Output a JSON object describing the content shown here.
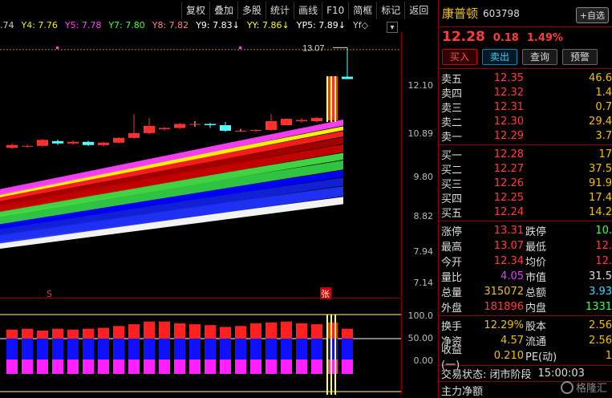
{
  "toolbar": [
    "复权",
    "叠加",
    "多股",
    "统计",
    "画线",
    "F10",
    "简框",
    "标记",
    "返回"
  ],
  "ma_row": [
    {
      "label": ".74",
      "color": "#cccccc"
    },
    {
      "label": "Y4: 7.76",
      "color": "#f0f000"
    },
    {
      "label": "Y5: 7.78",
      "color": "#ff40ff"
    },
    {
      "label": "Y7: 7.80",
      "color": "#40ff40"
    },
    {
      "label": "Y8: 7.82",
      "color": "#ff8080"
    },
    {
      "label": "Y9: 7.83↓",
      "color": "#ffffff"
    },
    {
      "label": "YY: 7.86↓",
      "color": "#ffff00"
    },
    {
      "label": "YP5: 7.89↓",
      "color": "#ffffff"
    },
    {
      "label": "Yf◇",
      "color": "#cccccc"
    }
  ],
  "ma_menu_icon": "menu-icon",
  "price_axis": [
    "12.10",
    "10.89",
    "9.80",
    "8.82",
    "7.94",
    "7.14"
  ],
  "osc_axis": [
    "100.0",
    "50.00",
    "0.00"
  ],
  "chart_annotations": {
    "high_label": "13.07",
    "s_marker": "S",
    "zhang_marker": "张"
  },
  "chart_data": {
    "type": "candlestick",
    "candles": [
      {
        "o": 10.55,
        "c": 10.62,
        "h": 10.66,
        "l": 10.52
      },
      {
        "o": 10.58,
        "c": 10.6,
        "h": 10.63,
        "l": 10.55
      },
      {
        "o": 10.6,
        "c": 10.75,
        "h": 10.78,
        "l": 10.57
      },
      {
        "o": 10.72,
        "c": 10.66,
        "h": 10.76,
        "l": 10.62
      },
      {
        "o": 10.66,
        "c": 10.7,
        "h": 10.74,
        "l": 10.63
      },
      {
        "o": 10.7,
        "c": 10.62,
        "h": 10.73,
        "l": 10.6
      },
      {
        "o": 10.62,
        "c": 10.68,
        "h": 10.7,
        "l": 10.58
      },
      {
        "o": 10.68,
        "c": 10.8,
        "h": 10.82,
        "l": 10.66
      },
      {
        "o": 10.8,
        "c": 10.92,
        "h": 11.4,
        "l": 10.78
      },
      {
        "o": 10.92,
        "c": 11.1,
        "h": 11.3,
        "l": 10.88
      },
      {
        "o": 11.02,
        "c": 11.05,
        "h": 11.08,
        "l": 10.98
      },
      {
        "o": 11.05,
        "c": 11.15,
        "h": 11.18,
        "l": 11.02
      },
      {
        "o": 11.15,
        "c": 11.15,
        "h": 11.22,
        "l": 11.08
      },
      {
        "o": 11.15,
        "c": 11.12,
        "h": 11.18,
        "l": 11.05
      },
      {
        "o": 11.12,
        "c": 10.98,
        "h": 11.2,
        "l": 10.95
      },
      {
        "o": 10.98,
        "c": 10.98,
        "h": 11.03,
        "l": 10.95
      },
      {
        "o": 10.98,
        "c": 11.0,
        "h": 11.02,
        "l": 10.95
      },
      {
        "o": 11.0,
        "c": 11.22,
        "h": 11.4,
        "l": 10.98
      },
      {
        "o": 11.12,
        "c": 11.28,
        "h": 11.3,
        "l": 11.12
      },
      {
        "o": 11.22,
        "c": 11.25,
        "h": 11.3,
        "l": 11.18
      },
      {
        "o": 11.22,
        "c": 11.3,
        "h": 11.33,
        "l": 11.18
      },
      {
        "o": 11.24,
        "c": 12.35,
        "h": 12.35,
        "l": 11.2
      },
      {
        "o": 12.34,
        "c": 12.28,
        "h": 13.07,
        "l": 12.28
      }
    ],
    "ylim": [
      6.8,
      13.3
    ],
    "osc_values": [
      70,
      72,
      68,
      72,
      70,
      72,
      74,
      78,
      82,
      88,
      88,
      84,
      82,
      80,
      76,
      78,
      84,
      86,
      88,
      84,
      82,
      86,
      72
    ],
    "osc_ylim": [
      0,
      100
    ]
  },
  "quote": {
    "name": "康普顿",
    "code": "603798",
    "self_select": "+自选",
    "last": "12.28",
    "change": "0.18",
    "pct": "1.49%",
    "buttons": {
      "buy": "买入",
      "sell": "卖出",
      "query": "查询",
      "warn": "预警"
    }
  },
  "order_book": {
    "asks": [
      {
        "label": "卖五",
        "price": "12.35",
        "vol": "46.6"
      },
      {
        "label": "卖四",
        "price": "12.32",
        "vol": "1.4"
      },
      {
        "label": "卖三",
        "price": "12.31",
        "vol": "0.7"
      },
      {
        "label": "卖二",
        "price": "12.30",
        "vol": "29.4"
      },
      {
        "label": "卖一",
        "price": "12.29",
        "vol": "3.7"
      }
    ],
    "bids": [
      {
        "label": "买一",
        "price": "12.28",
        "vol": "17"
      },
      {
        "label": "买二",
        "price": "12.27",
        "vol": "37.5"
      },
      {
        "label": "买三",
        "price": "12.26",
        "vol": "91.9"
      },
      {
        "label": "买四",
        "price": "12.25",
        "vol": "17.4"
      },
      {
        "label": "买五",
        "price": "12.24",
        "vol": "14.2"
      }
    ]
  },
  "stats1": [
    {
      "l1": "涨停",
      "v1": "13.31",
      "c1": "#ff3b3b",
      "l2": "跌停",
      "v2": "10.",
      "c2": "#40ff40"
    },
    {
      "l1": "最高",
      "v1": "13.07",
      "c1": "#ff3b3b",
      "l2": "最低",
      "v2": "12.",
      "c2": "#ff3b3b"
    },
    {
      "l1": "今开",
      "v1": "12.34",
      "c1": "#ff3b3b",
      "l2": "均价",
      "v2": "12.",
      "c2": "#ff3b3b"
    },
    {
      "l1": "量比",
      "v1": "4.05",
      "c1": "#e040ff",
      "l2": "市值",
      "v2": "31.5",
      "c2": "#dddddd"
    },
    {
      "l1": "总量",
      "v1": "315072",
      "c1": "#f0c000",
      "l2": "总额",
      "v2": "3.93",
      "c2": "#40d0ff"
    },
    {
      "l1": "外盘",
      "v1": "181896",
      "c1": "#ff3b3b",
      "l2": "内盘",
      "v2": "1331",
      "c2": "#40ff40"
    }
  ],
  "stats2": [
    {
      "l1": "换手",
      "v1": "12.29%",
      "c1": "#f0c000",
      "l2": "股本",
      "v2": "2.56",
      "c2": "#f0c000"
    },
    {
      "l1": "净资",
      "v1": "4.57",
      "c1": "#f0c000",
      "l2": "流通",
      "v2": "2.56",
      "c2": "#f0c000"
    },
    {
      "l1": "收益(一)",
      "v1": "0.210",
      "c1": "#f0c000",
      "l2": "PE(动)",
      "v2": "1",
      "c2": "#f0c000"
    }
  ],
  "trade_status": {
    "label": "交易状态: 闭市阶段",
    "time": "15:00:03"
  },
  "main_flow": {
    "label": "主力净额"
  },
  "watermark": "格隆汇"
}
